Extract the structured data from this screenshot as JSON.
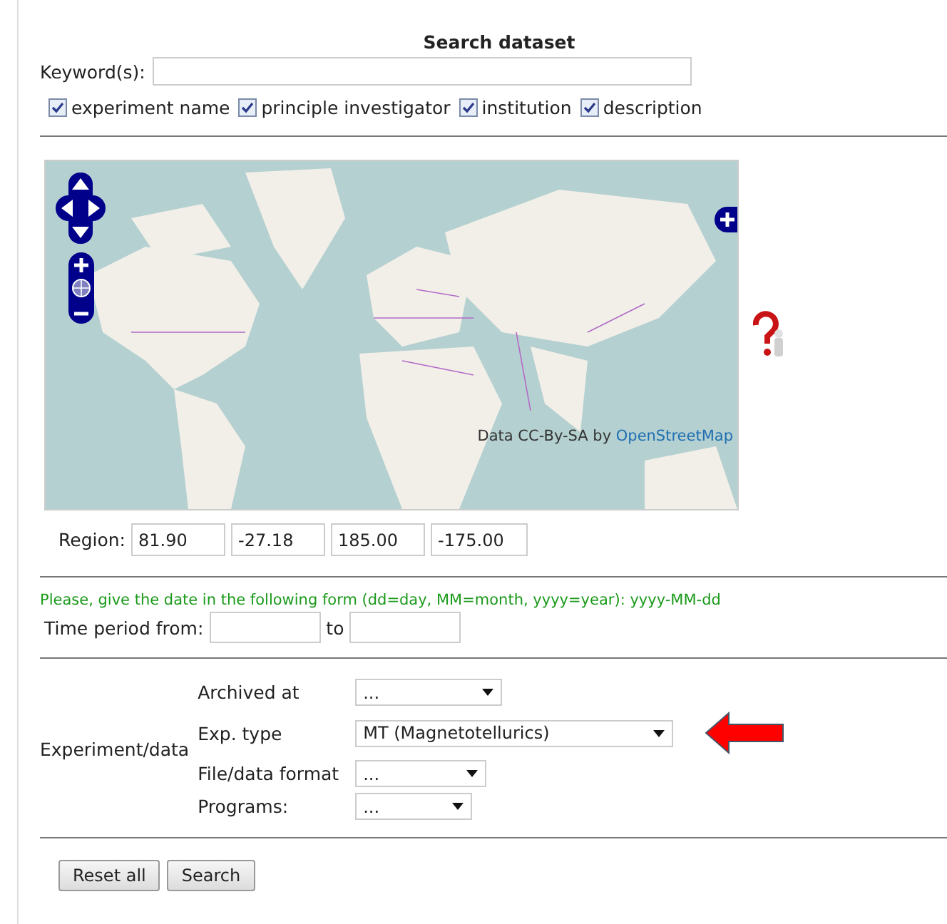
{
  "title": "Search dataset",
  "keyword": {
    "label": "Keyword(s):"
  },
  "search_fields": [
    {
      "label": "experiment name",
      "checked": true
    },
    {
      "label": "principle investigator",
      "checked": true
    },
    {
      "label": "institution",
      "checked": true
    },
    {
      "label": "description",
      "checked": true
    }
  ],
  "map": {
    "kind": "picture",
    "attribution": "Data CC-By-SA by",
    "attribution_link": "OpenStreetMap"
  },
  "region": {
    "label": "Region:",
    "values": [
      "81.90",
      "-27.18",
      "185.00",
      "-175.00"
    ]
  },
  "date_hint": "Please, give the date in the following form (dd=day, MM=month, yyyy=year): yyyy-MM-dd",
  "time_period": {
    "label": "Time period from:",
    "to_label": "to"
  },
  "experiment": {
    "label": "Experiment/data",
    "filters": [
      {
        "label": "Archived at",
        "value": "..."
      },
      {
        "label": "Exp. type",
        "value": "MT (Magnetotellurics)"
      },
      {
        "label": "File/data format",
        "value": "..."
      },
      {
        "label": "Programs:",
        "value": "..."
      }
    ]
  },
  "buttons": [
    "Reset all",
    "Search"
  ]
}
